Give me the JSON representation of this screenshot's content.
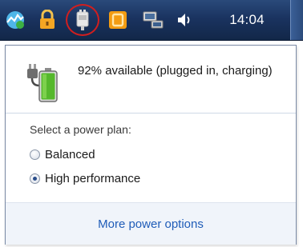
{
  "taskbar": {
    "clock": "14:04",
    "icons": [
      "network-activity-icon",
      "lock-icon",
      "power-plug-icon",
      "orange-app-icon",
      "network-wired-icon",
      "volume-icon"
    ],
    "colors": {
      "background": "#1a3360",
      "highlight_ring": "#d21e1e"
    }
  },
  "power_flyout": {
    "battery": {
      "status_text": "92% available (plugged in, charging)",
      "charge_percent": 92,
      "plugged_in": true
    },
    "plan_prompt": "Select a power plan:",
    "plans": [
      {
        "label": "Balanced",
        "selected": false
      },
      {
        "label": "High performance",
        "selected": true
      }
    ],
    "more_options_link": "More power options",
    "colors": {
      "link": "#1f5cb8",
      "footer_background": "#f0f4fa",
      "battery_fill": "#55b82c"
    }
  }
}
